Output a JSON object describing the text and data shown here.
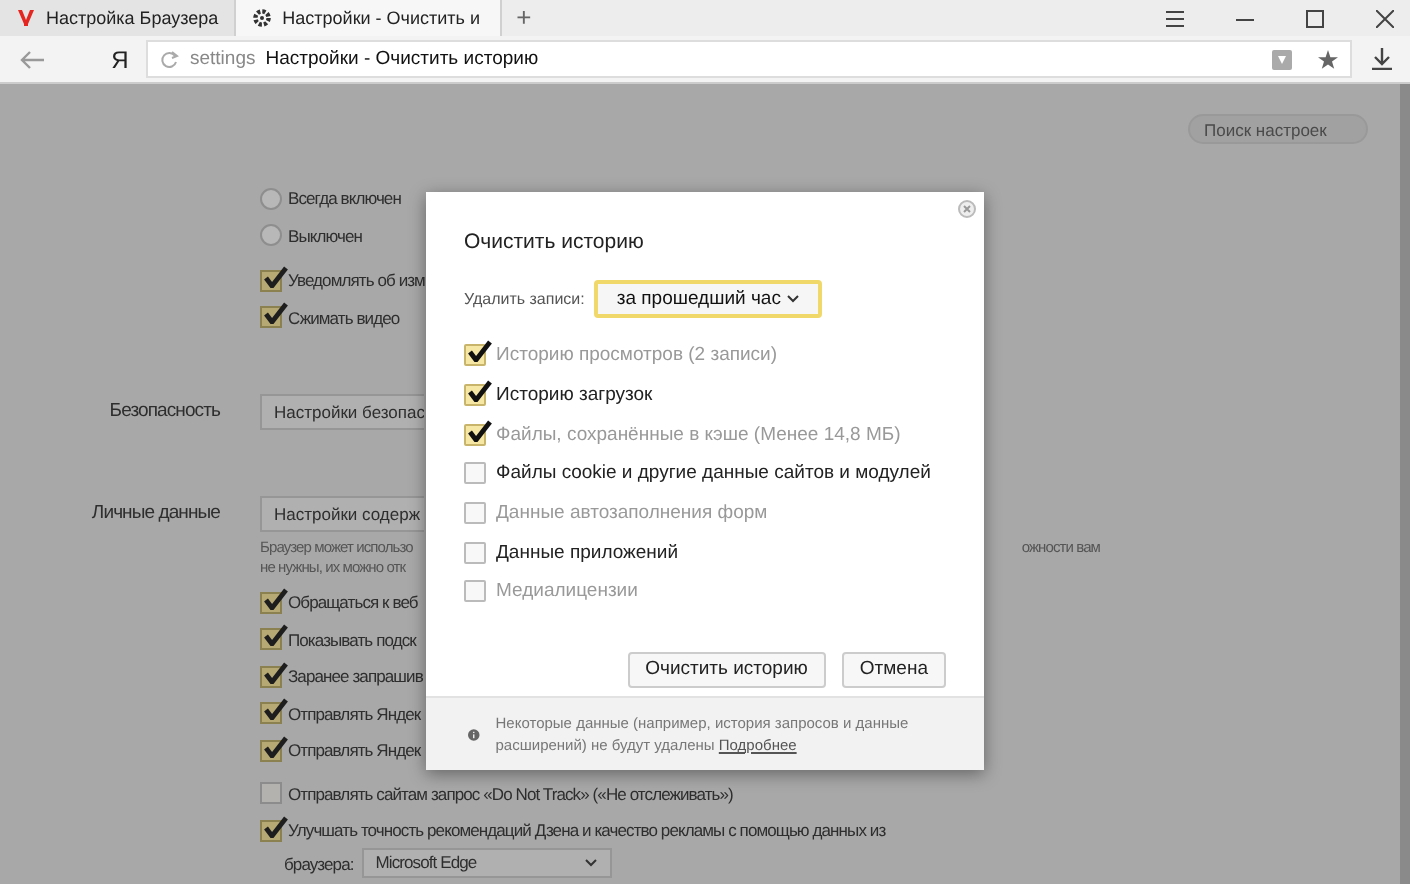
{
  "tabs": [
    {
      "label": "Настройка Браузера",
      "selected": false
    },
    {
      "label": "Настройки - Очистить и",
      "selected": true
    }
  ],
  "new_tab": "+",
  "address_bar": {
    "logo": "Я",
    "scheme": "settings",
    "title": "Настройки - Очистить историю"
  },
  "settings": {
    "search": {
      "placeholder": "Поиск настроек"
    },
    "options": [
      {
        "kind": "radio",
        "label": "Всегда включен",
        "selected": false
      },
      {
        "kind": "radio",
        "label": "Выключен",
        "selected": false
      },
      {
        "kind": "checkbox",
        "label": "Уведомлять об изм",
        "checked": true
      },
      {
        "kind": "checkbox",
        "label": "Сжимать видео",
        "checked": true
      }
    ],
    "sections": [
      {
        "label": "Безопасность",
        "button": "Настройки безопас"
      },
      {
        "label": "Личные данные",
        "button": "Настройки содерж",
        "note": [
          "Браузер может использо",
          "не нужны, их можно отк"
        ],
        "note_tail": "ожности вам"
      }
    ],
    "privacy_options": [
      {
        "label": "Обращаться к веб",
        "checked": true
      },
      {
        "label": "Показывать подск",
        "checked": true
      },
      {
        "label": "Заранее запрашив",
        "checked": true
      },
      {
        "label": "Отправлять Яндек",
        "checked": true
      },
      {
        "label": "Отправлять Яндек",
        "checked": true
      },
      {
        "label": "Отправлять сайтам запрос «Do Not Track» («Не отслеживать»)",
        "checked": false
      },
      {
        "label": "Улучшать точность рекомендаций Дзена и качество рекламы с помощью данных из",
        "checked": true
      }
    ],
    "browser_import": {
      "label": "браузера:",
      "value": "Microsoft Edge"
    }
  },
  "dialog": {
    "title": "Очистить историю",
    "period_label": "Удалить записи:",
    "period": "за прошедший час",
    "items": [
      {
        "label": "Историю просмотров (2 записи)",
        "checked": true,
        "disabled": true
      },
      {
        "label": "Историю загрузок",
        "checked": true,
        "disabled": false
      },
      {
        "label": "Файлы, сохранённые в кэше (Менее 14,8 МБ)",
        "checked": true,
        "disabled": true
      },
      {
        "label": "Файлы cookie и другие данные сайтов и модулей",
        "checked": false,
        "disabled": false
      },
      {
        "label": "Данные автозаполнения форм",
        "checked": false,
        "disabled": true
      },
      {
        "label": "Данные приложений",
        "checked": false,
        "disabled": false
      },
      {
        "label": "Медиалицензии",
        "checked": false,
        "disabled": true
      }
    ],
    "buttons": [
      "Очистить историю",
      "Отмена"
    ],
    "footer": {
      "text": "Некоторые данные (например, история запросов и данные расширений) не будут удалены",
      "link": "Подробнее"
    }
  }
}
